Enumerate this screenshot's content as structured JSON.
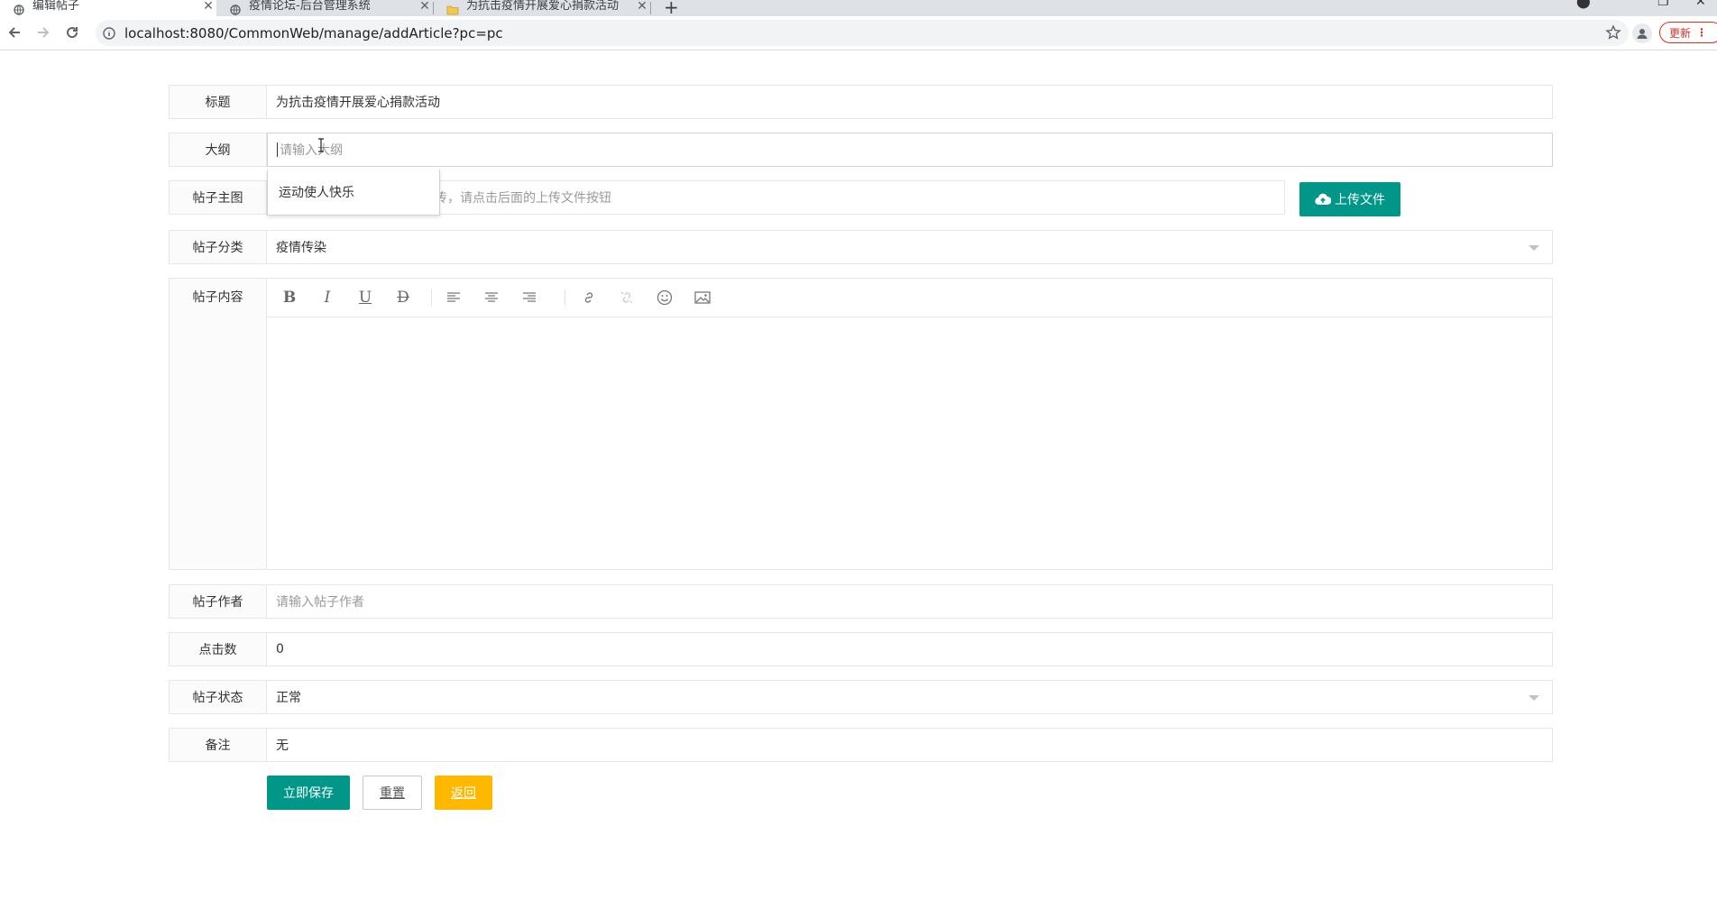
{
  "browser": {
    "tabs": [
      {
        "title": "编辑帖子",
        "active": true
      },
      {
        "title": "疫情论坛-后台管理系统",
        "active": false
      },
      {
        "title": "为抗击疫情开展爱心捐款活动",
        "active": false
      }
    ],
    "url": "localhost:8080/CommonWeb/manage/addArticle?pc=pc",
    "update_label": "更新"
  },
  "form": {
    "title": {
      "label": "标题",
      "value": "为抗击疫情开展爱心捐款活动"
    },
    "outline": {
      "label": "大纲",
      "placeholder": "请输入大纲"
    },
    "outline_suggestion": "运动使人快乐",
    "main_image": {
      "label": "帖子主图",
      "placeholder": "上传，请点击后面的上传文件按钮",
      "upload_label": "上传文件"
    },
    "category": {
      "label": "帖子分类",
      "value": "疫情传染"
    },
    "content": {
      "label": "帖子内容"
    },
    "author": {
      "label": "帖子作者",
      "placeholder": "请输入帖子作者"
    },
    "clicks": {
      "label": "点击数",
      "value": "0"
    },
    "status": {
      "label": "帖子状态",
      "value": "正常"
    },
    "remark": {
      "label": "备注",
      "value": "无"
    }
  },
  "editor_toolbar": [
    "bold-icon",
    "italic-icon",
    "underline-icon",
    "strikethrough-icon",
    "align-left-icon",
    "align-center-icon",
    "align-right-icon",
    "link-icon",
    "unlink-icon",
    "emoji-icon",
    "image-icon"
  ],
  "actions": {
    "save_label": "立即保存",
    "reset_label": "重置",
    "back_label": "返回"
  },
  "colors": {
    "primary": "#009688",
    "warn": "#ffb800",
    "update": "#d93025"
  }
}
